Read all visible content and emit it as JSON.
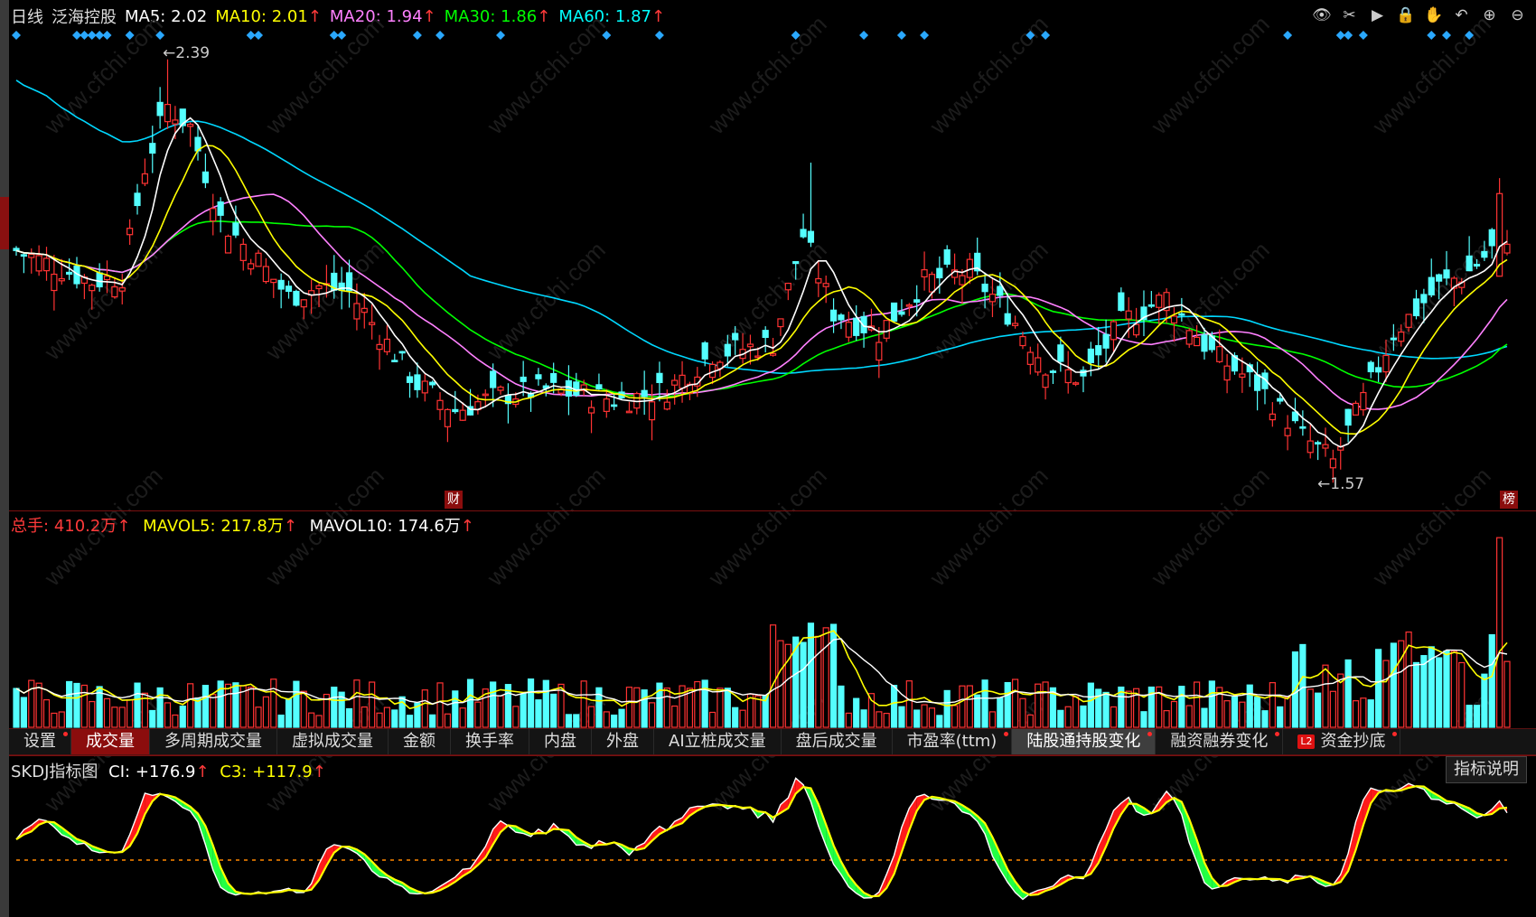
{
  "header": {
    "period": "日线",
    "stock_name": "泛海控股",
    "ma": [
      {
        "label": "MA5:",
        "value": "2.02",
        "color": "#ffffff"
      },
      {
        "label": "MA10:",
        "value": "2.01",
        "color": "#ffff00"
      },
      {
        "label": "MA20:",
        "value": "1.94",
        "color": "#ff80ff"
      },
      {
        "label": "MA30:",
        "value": "1.86",
        "color": "#00ff00"
      },
      {
        "label": "MA60:",
        "value": "1.87",
        "color": "#00ffff"
      }
    ],
    "up_arrow": "↑"
  },
  "toolbar": [
    "eye-icon",
    "scissors-icon",
    "replay-icon",
    "lock-icon",
    "hand-icon",
    "undo-icon",
    "zoom-in-icon",
    "zoom-out-icon"
  ],
  "price_chart": {
    "high_label": "2.39",
    "low_label": "1.57",
    "finance_badge": "财",
    "rank_badge": "榜"
  },
  "volume": {
    "total_label": "总手:",
    "total_value": "410.2万",
    "mavol5_label": "MAVOL5:",
    "mavol5_value": "217.8万",
    "mavol10_label": "MAVOL10:",
    "mavol10_value": "174.6万"
  },
  "tabs": [
    {
      "label": "设置",
      "dot": true
    },
    {
      "label": "成交量",
      "dot": false,
      "active": true
    },
    {
      "label": "多周期成交量",
      "dot": false
    },
    {
      "label": "虚拟成交量",
      "dot": false
    },
    {
      "label": "金额",
      "dot": false
    },
    {
      "label": "换手率",
      "dot": false
    },
    {
      "label": "内盘",
      "dot": false
    },
    {
      "label": "外盘",
      "dot": false
    },
    {
      "label": "AI立桩成交量",
      "dot": false
    },
    {
      "label": "盘后成交量",
      "dot": false
    },
    {
      "label": "市盈率(ttm)",
      "dot": true
    },
    {
      "label": "陆股通持股变化",
      "dot": true,
      "highlight": true
    },
    {
      "label": "融资融券变化",
      "dot": true
    },
    {
      "label": "资金抄底",
      "dot": true,
      "l2": true
    }
  ],
  "l2_tag": "L2",
  "skdj": {
    "title": "SKDJ指标图",
    "ci_label": "CI:",
    "ci_value": "+176.9",
    "c3_label": "C3:",
    "c3_value": "+117.9",
    "explain": "指标说明"
  },
  "colors": {
    "rise": "#ff3333",
    "fall": "#54ffff",
    "border": "#7a1010"
  }
}
